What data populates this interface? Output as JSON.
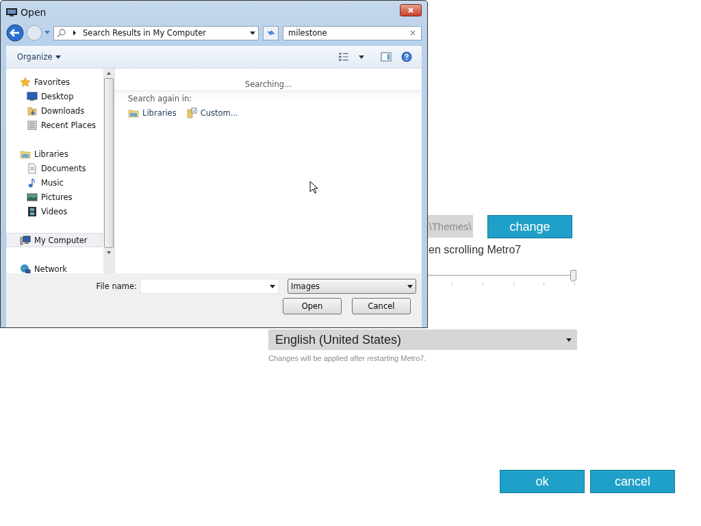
{
  "dialog": {
    "title": "Open",
    "address": {
      "crumb": "Search Results in My Computer"
    },
    "search": {
      "value": "milestone"
    },
    "toolbar": {
      "organize": "Organize"
    },
    "nav": [
      {
        "label": "Favorites",
        "kind": "star",
        "selected": false,
        "children": [
          {
            "label": "Desktop",
            "kind": "desktop",
            "selected": false
          },
          {
            "label": "Downloads",
            "kind": "downloads",
            "selected": false
          },
          {
            "label": "Recent Places",
            "kind": "recent",
            "selected": false
          }
        ]
      },
      {
        "label": "Libraries",
        "kind": "libraries",
        "selected": false,
        "children": [
          {
            "label": "Documents",
            "kind": "document",
            "selected": false
          },
          {
            "label": "Music",
            "kind": "music",
            "selected": false
          },
          {
            "label": "Pictures",
            "kind": "pictures",
            "selected": false
          },
          {
            "label": "Videos",
            "kind": "videos",
            "selected": false
          }
        ]
      },
      {
        "label": "My Computer",
        "kind": "computer",
        "selected": true
      },
      {
        "label": "Network",
        "kind": "network",
        "selected": false
      }
    ],
    "content": {
      "status": "Searching...",
      "search_again_label": "Search again in:",
      "locations": [
        {
          "label": "Libraries",
          "kind": "libraries"
        },
        {
          "label": "Custom...",
          "kind": "custom"
        }
      ]
    },
    "file_name": {
      "label": "File name:"
    },
    "file_type": {
      "value": "Images"
    },
    "buttons": [
      {
        "label": "Open"
      },
      {
        "label": "Cancel"
      }
    ]
  },
  "settings": {
    "theme_path": {
      "value": "\\Themes\\"
    },
    "change_button": "change",
    "scroll_option": "en scrolling Metro7",
    "slider": {
      "level": 0.99
    },
    "language": {
      "value": "English (United States)"
    },
    "language_note": "Changes will be applied after restarting Metro7.",
    "buttons": [
      {
        "label": "ok"
      },
      {
        "label": "cancel"
      }
    ]
  }
}
